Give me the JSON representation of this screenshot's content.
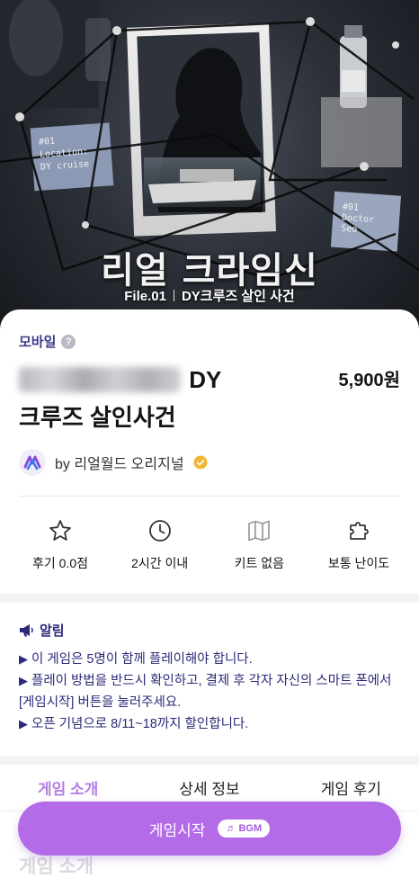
{
  "hero": {
    "title": "리얼 크라임신",
    "file_no": "File.01",
    "case_name": "DY크루즈 살인 사건",
    "note_left_lines": [
      "#01",
      "Location:",
      "DY cruise"
    ],
    "note_right_lines": [
      "#01",
      "Doctor",
      "Seo"
    ]
  },
  "product": {
    "platform": "모바일",
    "help_icon": "?",
    "title_suffix_line1": "DY",
    "title_line2": "크루즈 살인사건",
    "price": "5,900원",
    "maker": "by 리얼월드 오리지널"
  },
  "stats": [
    {
      "icon": "star-outline-icon",
      "label": "후기 0.0점"
    },
    {
      "icon": "clock-icon",
      "label": "2시간 이내"
    },
    {
      "icon": "map-icon",
      "label": "키트 없음"
    },
    {
      "icon": "puzzle-icon",
      "label": "보통 난이도"
    }
  ],
  "notice": {
    "heading": "알림",
    "lines": [
      "이 게임은 5명이 함께 플레이해야 합니다.",
      "플레이 방법을 반드시 확인하고, 결제 후 각자 자신의 스마트 폰에서 [게임시작] 버튼을 눌러주세요.",
      "오픈 기념으로 8/11~18까지 할인합니다."
    ],
    "bullet": "▶"
  },
  "tabs": [
    {
      "label": "게임 소개",
      "active": true
    },
    {
      "label": "상세 정보",
      "active": false
    },
    {
      "label": "게임 후기",
      "active": false
    }
  ],
  "section_heading": "게임 소개",
  "cta": {
    "label": "게임시작",
    "badge": "BGM",
    "badge_icon": "♬"
  },
  "colors": {
    "accent": "#b36be8",
    "navy": "#2b2b7a",
    "gold": "#f2b632"
  }
}
